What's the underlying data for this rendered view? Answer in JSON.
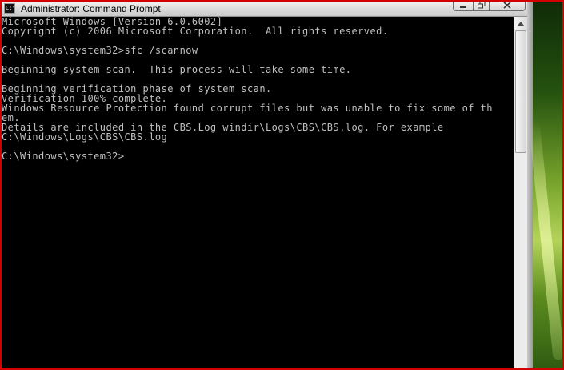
{
  "window": {
    "title": "Administrator: Command Prompt",
    "app_icon_text": "C:\\"
  },
  "caption_buttons": [
    "minimize",
    "maximize",
    "close"
  ],
  "console": {
    "lines": [
      "Microsoft Windows [Version 6.0.6002]",
      "Copyright (c) 2006 Microsoft Corporation.  All rights reserved.",
      "",
      "C:\\Windows\\system32>sfc /scannow",
      "",
      "Beginning system scan.  This process will take some time.",
      "",
      "Beginning verification phase of system scan.",
      "Verification 100% complete.",
      "Windows Resource Protection found corrupt files but was unable to fix some of th",
      "em.",
      "Details are included in the CBS.Log windir\\Logs\\CBS\\CBS.log. For example",
      "C:\\Windows\\Logs\\CBS\\CBS.log",
      "",
      "C:\\Windows\\system32>"
    ]
  },
  "colors": {
    "console_bg": "#000000",
    "console_text": "#c0c0c0",
    "highlight_border": "#d40000"
  }
}
